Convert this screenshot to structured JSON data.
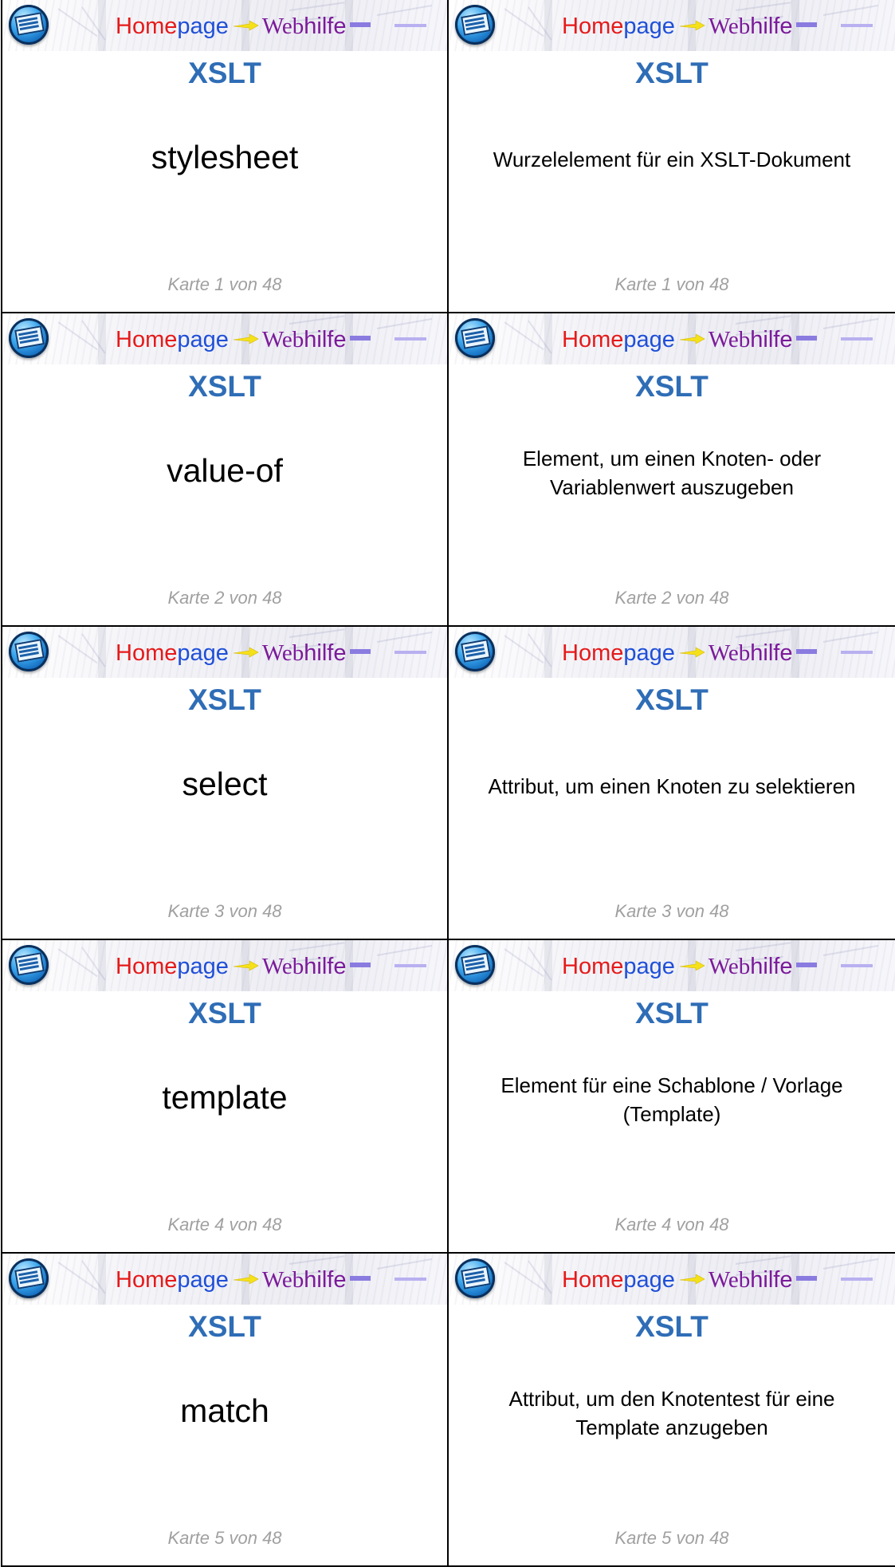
{
  "brand": {
    "home": "Home",
    "page": "page",
    "web": "Web",
    "hilfe": "hilfe"
  },
  "colors": {
    "heading": "#2f6db6",
    "home": "#e51a1a",
    "page": "#1f4fd8",
    "webhilfe": "#7b1a9a",
    "footer": "#a0a0a0"
  },
  "cards": [
    {
      "heading": "XSLT",
      "front": "stylesheet",
      "back": "Wurzelelement für ein XSLT-Dokument",
      "number": "Karte 1 von 48"
    },
    {
      "heading": "XSLT",
      "front": "value-of",
      "back": "Element, um einen Knoten- oder Variablenwert auszugeben",
      "number": "Karte 2 von 48"
    },
    {
      "heading": "XSLT",
      "front": "select",
      "back": "Attribut, um einen Knoten zu selektieren",
      "number": "Karte 3 von 48"
    },
    {
      "heading": "XSLT",
      "front": "template",
      "back": "Element für eine Schablone / Vorlage (Template)",
      "number": "Karte 4 von 48"
    },
    {
      "heading": "XSLT",
      "front": "match",
      "back": "Attribut, um den Knotentest für eine Template anzugeben",
      "number": "Karte 5 von 48"
    }
  ]
}
